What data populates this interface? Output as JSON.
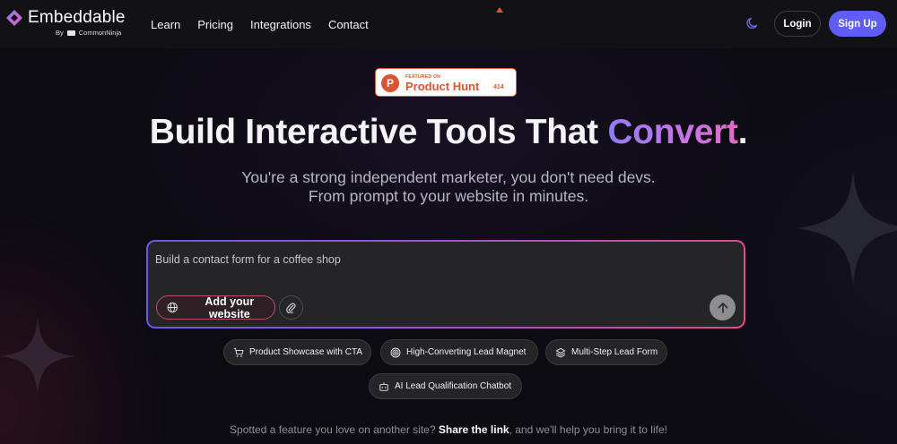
{
  "brand": {
    "name": "Embeddable",
    "by_label": "By",
    "by_company": "CommonNinja"
  },
  "nav": {
    "items": [
      {
        "label": "Learn"
      },
      {
        "label": "Pricing"
      },
      {
        "label": "Integrations"
      },
      {
        "label": "Contact"
      }
    ]
  },
  "header": {
    "login_label": "Login",
    "signup_label": "Sign Up",
    "theme_icon": "moon-icon"
  },
  "product_hunt": {
    "featured_label": "FEATURED ON",
    "name": "Product Hunt",
    "count": "414"
  },
  "hero": {
    "title_main": "Build Interactive Tools That",
    "title_accent": "Convert",
    "title_end": ".",
    "subtitle_line1": "You're a strong independent marketer, you don't need devs.",
    "subtitle_line2": "From prompt to your website in minutes."
  },
  "prompt": {
    "placeholder": "Build a contact form for a coffee shop",
    "add_website_label": "Add your website",
    "attach_icon": "paperclip-icon",
    "send_icon": "arrow-up-icon"
  },
  "chips": [
    {
      "label": "Product Showcase with CTA",
      "icon": "cart-icon"
    },
    {
      "label": "High-Converting Lead Magnet",
      "icon": "target-icon"
    },
    {
      "label": "Multi-Step Lead Form",
      "icon": "layers-icon"
    },
    {
      "label": "AI Lead Qualification Chatbot",
      "icon": "robot-icon"
    }
  ],
  "footer": {
    "text_before": "Spotted a feature you love on another site?",
    "link_text": "Share the link",
    "text_after": ", and we'll help you bring it to life!"
  },
  "colors": {
    "background": "#0d0b12",
    "header_bg": "#121116",
    "signup_bg": "#5f5df5",
    "accent_gradient_start": "#8c7cf5",
    "accent_gradient_end": "#e06bc2",
    "product_hunt": "#da552f"
  }
}
